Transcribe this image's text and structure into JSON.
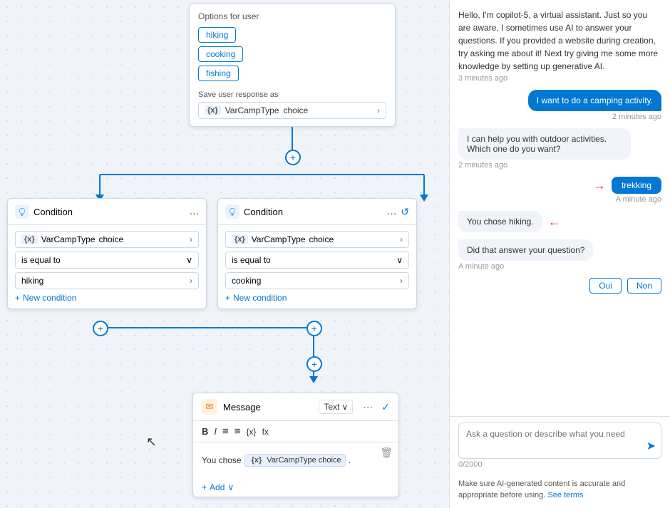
{
  "canvas": {
    "options_card": {
      "title": "Options for user",
      "options": [
        "hiking",
        "cooking",
        "fishing"
      ],
      "save_label": "Save user response as",
      "var_tag": "{x}",
      "var_name": "VarCampType",
      "var_type": "choice"
    },
    "condition1": {
      "title": "Condition",
      "header_icon": "{x}",
      "var_name": "VarCampType",
      "var_type": "choice",
      "operator": "is equal to",
      "value": "hiking",
      "add_label": "New condition",
      "dots": "...",
      "check": "✓"
    },
    "condition2": {
      "title": "Condition",
      "header_icon": "{x}",
      "var_name": "VarCampType",
      "var_type": "choice",
      "operator": "is equal to",
      "value": "cooking",
      "add_label": "New condition",
      "dots": "...",
      "clock": "↺"
    },
    "message_card": {
      "title": "Message",
      "icon": "✉",
      "text_label": "Text",
      "toolbar": [
        "B",
        "I",
        "≡",
        "≡",
        "{x}",
        "fx"
      ],
      "content_prefix": "You chose",
      "var_tag": "{x}",
      "var_name": "VarCampType",
      "var_type": "choice",
      "content_suffix": ".",
      "delete_icon": "🗑",
      "add_label": "Add"
    }
  },
  "chat": {
    "intro_text": "Hello, I'm copilot-5, a virtual assistant. Just so you are aware, I sometimes use AI to answer your questions. If you provided a website during creation, try asking me about it! Next try giving me some more knowledge by setting up generative AI.",
    "timestamp1": "3 minutes ago",
    "user_msg1": "I want to do a camping activity.",
    "timestamp2": "2 minutes ago",
    "bot_msg1": "I can help you with outdoor activities. Which one do you want?",
    "timestamp3": "2 minutes ago",
    "trekking_btn": "trekking",
    "timestamp4": "A minute ago",
    "bot_msg2": "You chose hiking.",
    "bot_msg3": "Did that answer your question?",
    "timestamp5": "A minute ago",
    "yes_btn": "Oui",
    "no_btn": "Non",
    "input_placeholder": "Ask a question or describe what you need",
    "char_count": "0/2000",
    "footer_text": "Make sure AI-generated content is accurate and appropriate before using.",
    "footer_link": "See terms"
  }
}
